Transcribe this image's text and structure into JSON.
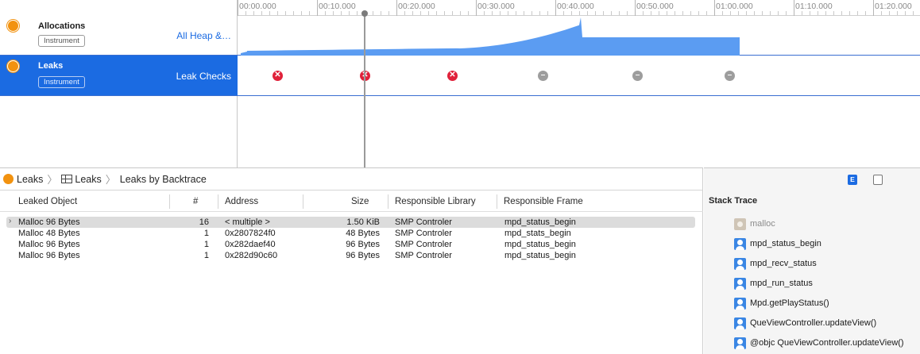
{
  "timeline": {
    "ruler_labels": [
      "00:00.000",
      "00:10.000",
      "00:20.000",
      "00:30.000",
      "00:40.000",
      "00:50.000",
      "01:00.000",
      "01:10.000",
      "01:20.000"
    ],
    "tracks": [
      {
        "title": "Allocations",
        "badge": "Instrument",
        "detail": "All Heap &…"
      },
      {
        "title": "Leaks",
        "badge": "Instrument",
        "detail": "Leak Checks"
      }
    ],
    "leak_checks": [
      {
        "status": "leak",
        "glyph": "✕"
      },
      {
        "status": "leak",
        "glyph": "✕"
      },
      {
        "status": "leak",
        "glyph": "✕"
      },
      {
        "status": "ok",
        "glyph": "–"
      },
      {
        "status": "ok",
        "glyph": "–"
      },
      {
        "status": "ok",
        "glyph": "–"
      }
    ],
    "colors": {
      "selected_track": "#1b6be2",
      "alloc_fill": "#5b9cf2",
      "leak": "#e0213a",
      "no_leak": "#9d9d9d"
    }
  },
  "breadcrumb": {
    "instrument": "Leaks",
    "view": "Leaks",
    "mode": "Leaks by Backtrace"
  },
  "table": {
    "columns": [
      "Leaked Object",
      "#",
      "Address",
      "Size",
      "Responsible Library",
      "Responsible Frame"
    ],
    "rows": [
      {
        "object": "Malloc 96 Bytes",
        "count": "16",
        "address": "< multiple >",
        "size": "1.50 KiB",
        "library": "SMP Controler",
        "frame": "mpd_status_begin",
        "expandable": true
      },
      {
        "object": "Malloc 48 Bytes",
        "count": "1",
        "address": "0x2807824f0",
        "size": "48 Bytes",
        "library": "SMP Controler",
        "frame": "mpd_stats_begin",
        "expandable": false
      },
      {
        "object": "Malloc 96 Bytes",
        "count": "1",
        "address": "0x282daef40",
        "size": "96 Bytes",
        "library": "SMP Controler",
        "frame": "mpd_status_begin",
        "expandable": false
      },
      {
        "object": "Malloc 96 Bytes",
        "count": "1",
        "address": "0x282d90c60",
        "size": "96 Bytes",
        "library": "SMP Controler",
        "frame": "mpd_status_begin",
        "expandable": false
      }
    ]
  },
  "inspector": {
    "title": "Stack Trace",
    "extended_button": "E",
    "frames": [
      {
        "name": "malloc",
        "kind": "system"
      },
      {
        "name": "mpd_status_begin",
        "kind": "user"
      },
      {
        "name": "mpd_recv_status",
        "kind": "user"
      },
      {
        "name": "mpd_run_status",
        "kind": "user"
      },
      {
        "name": "Mpd.getPlayStatus()",
        "kind": "user"
      },
      {
        "name": "QueViewController.updateView()",
        "kind": "user"
      },
      {
        "name": "@objc QueViewController.updateView()",
        "kind": "user"
      }
    ]
  }
}
